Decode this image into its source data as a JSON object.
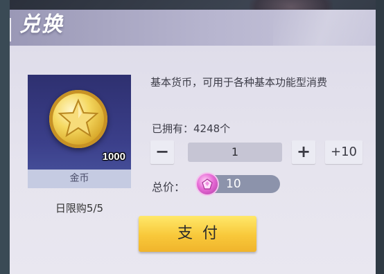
{
  "dialog": {
    "title": "兑换"
  },
  "item": {
    "name": "金币",
    "quantity": "1000",
    "icon": "gold-coin-star-icon",
    "daily_limit": "日限购5/5"
  },
  "details": {
    "description": "基本货币，可用于各种基本功能型消费",
    "owned": "已拥有：4248个"
  },
  "quantity_selector": {
    "minus_label": "−",
    "value": "1",
    "plus_label": "+",
    "plus10_label": "+10"
  },
  "total": {
    "label": "总价：",
    "currency_icon": "pink-gem-icon",
    "value": "10"
  },
  "pay_button": {
    "label": "支付"
  },
  "colors": {
    "accent_yellow": "#f8c83a",
    "card_blue": "#3b3f8a",
    "gem_pink": "#e76bd6"
  }
}
